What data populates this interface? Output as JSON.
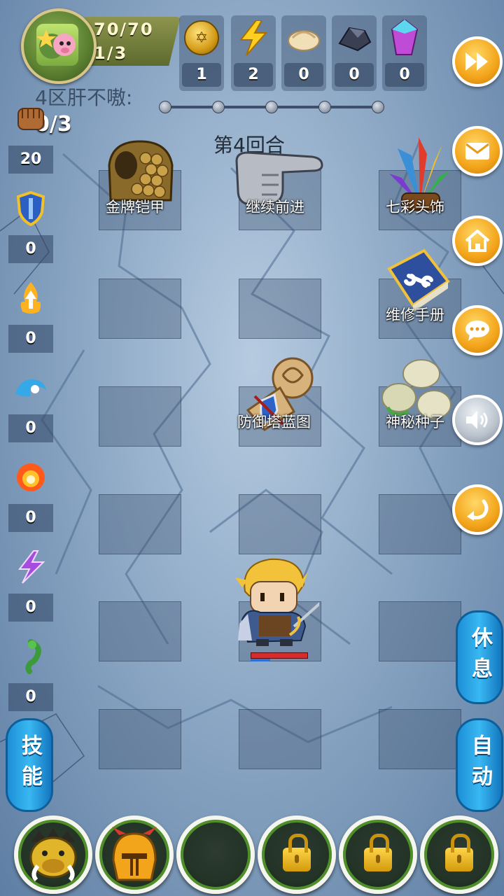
{
  "header": {
    "hp": "70/70",
    "level": "1/3",
    "resources": [
      {
        "name": "coin",
        "icon": "star-coin-icon",
        "value": "1"
      },
      {
        "name": "energy",
        "icon": "lightning-icon",
        "value": "2"
      },
      {
        "name": "food",
        "icon": "dumpling-icon",
        "value": "0"
      },
      {
        "name": "ore",
        "icon": "iron-ore-icon",
        "value": "0"
      },
      {
        "name": "crystal",
        "icon": "crystal-icon",
        "value": "0"
      }
    ]
  },
  "zone": {
    "title": "4区肝不嗷:",
    "progress": "0/3"
  },
  "round": "第4回合",
  "left_stats": [
    {
      "icon": "fist-icon",
      "value": "20"
    },
    {
      "icon": "shield-icon",
      "value": "0"
    },
    {
      "icon": "fire-arrow-icon",
      "value": "0"
    },
    {
      "icon": "water-wave-icon",
      "value": "0"
    },
    {
      "icon": "fireball-icon",
      "value": "0"
    },
    {
      "icon": "lightning-bolt-icon",
      "value": "0"
    },
    {
      "icon": "poison-icon",
      "value": "0"
    }
  ],
  "board_items": [
    {
      "label": "金牌铠甲"
    },
    {
      "label": "继续前进"
    },
    {
      "label": "七彩头饰"
    },
    {
      "label": "维修手册"
    },
    {
      "label": "防御塔蓝图"
    },
    {
      "label": "神秘种子"
    }
  ],
  "side_buttons": {
    "rest": "休息",
    "auto": "自动",
    "skill": "技能"
  },
  "hero_hp_fraction": 1.0,
  "hero_mp_fraction": 0.35,
  "colors": {
    "accent_orange": "#f3a41a",
    "pill_blue": "#1d8fd6",
    "ring_green": "#4f8f2a"
  }
}
